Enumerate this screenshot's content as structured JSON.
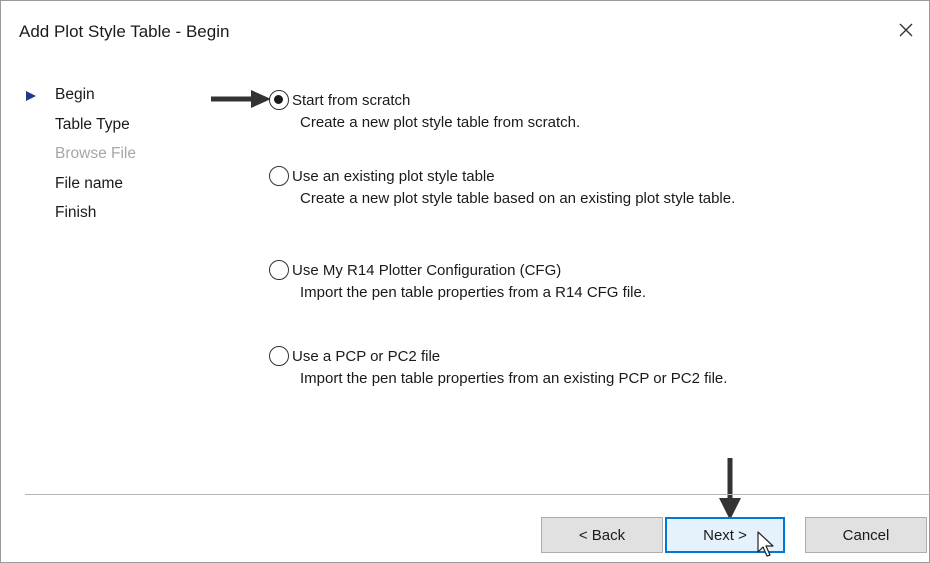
{
  "window": {
    "title": "Add Plot Style Table - Begin"
  },
  "steps": [
    {
      "label": "Begin",
      "current": true,
      "enabled": true
    },
    {
      "label": "Table Type",
      "current": false,
      "enabled": true
    },
    {
      "label": "Browse File",
      "current": false,
      "enabled": false
    },
    {
      "label": "File name",
      "current": false,
      "enabled": true
    },
    {
      "label": "Finish",
      "current": false,
      "enabled": true
    }
  ],
  "options": [
    {
      "label": "Start from scratch",
      "description": "Create a new plot style table from scratch.",
      "selected": true
    },
    {
      "label": "Use an existing plot style table",
      "description": "Create a new plot style table based on an existing plot style table.",
      "selected": false
    },
    {
      "label": "Use My R14 Plotter Configuration (CFG)",
      "description": "Import the pen table properties from a R14 CFG file.",
      "selected": false
    },
    {
      "label": "Use a PCP or PC2 file",
      "description": "Import the pen table properties from an existing PCP or PC2 file.",
      "selected": false
    }
  ],
  "buttons": {
    "back": "< Back",
    "next": "Next >",
    "cancel": "Cancel"
  },
  "icons": {
    "close": "close-icon",
    "step_marker": "play-triangle-icon",
    "annotation_arrow": "arrow-icon",
    "cursor": "mouse-pointer-icon"
  },
  "colors": {
    "step_marker": "#1f3a8f",
    "focus_border": "#0078d7",
    "disabled_text": "#a6a6a6"
  }
}
